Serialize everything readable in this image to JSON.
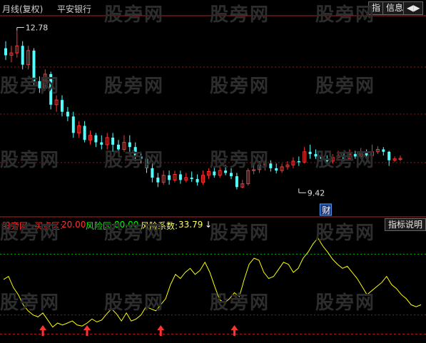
{
  "header": {
    "period": "月线(复权)",
    "stock": "平安银行",
    "btn_indicator": "指",
    "btn_info": "信息",
    "btn_arrows": "◀▶"
  },
  "watermark": "股旁网",
  "main_chart": {
    "high_label": "12.78",
    "low_label": "9.42",
    "finance_badge": "财"
  },
  "sub_header": {
    "name": "股旁网",
    "buy_zone_label": "买点区: ",
    "buy_zone_value": "20.00",
    "risk_zone_label": "风险区: ",
    "risk_zone_value": "80.00",
    "risk_coef_label": "风险系数: ",
    "risk_coef_value": "33.79",
    "risk_coef_arrow": "↓",
    "btn_explain": "指标说明"
  },
  "colors": {
    "up": "#ff3232",
    "down": "#54ffff",
    "grid": "#8a1a1a",
    "risk_line": "#00b000",
    "oscillator": "#ffff00",
    "label_buy": "#ff3232",
    "label_risk": "#00ff00",
    "label_coef": "#ffff60",
    "badge": "#5aa0ff"
  },
  "chart_data": [
    {
      "type": "candlestick",
      "title": "平安银行 月线(复权)",
      "ylim": [
        9.0,
        13.0
      ],
      "annotations": [
        {
          "text": "12.78",
          "price": 12.78,
          "candle_index": 2
        },
        {
          "text": "9.42",
          "price": 9.42,
          "candle_index": 52
        }
      ],
      "candles": [
        [
          12.4,
          12.25,
          12.55,
          12.15
        ],
        [
          12.25,
          12.3,
          12.45,
          12.1
        ],
        [
          12.3,
          12.45,
          12.78,
          12.2
        ],
        [
          12.45,
          12.05,
          12.55,
          11.95
        ],
        [
          12.05,
          12.35,
          12.45,
          11.95
        ],
        [
          12.35,
          11.7,
          12.4,
          11.6
        ],
        [
          11.7,
          11.55,
          11.8,
          11.45
        ],
        [
          11.55,
          11.85,
          11.95,
          11.5
        ],
        [
          11.85,
          11.2,
          11.9,
          11.1
        ],
        [
          11.2,
          11.3,
          11.4,
          11.05
        ],
        [
          11.3,
          11.05,
          11.4,
          10.95
        ],
        [
          11.05,
          10.95,
          11.15,
          10.85
        ],
        [
          10.95,
          10.6,
          11.05,
          10.5
        ],
        [
          10.6,
          10.75,
          10.85,
          10.5
        ],
        [
          10.75,
          10.45,
          10.85,
          10.4
        ],
        [
          10.45,
          10.55,
          10.65,
          10.35
        ],
        [
          10.55,
          10.4,
          10.6,
          10.3
        ],
        [
          10.4,
          10.35,
          10.55,
          10.25
        ],
        [
          10.35,
          10.5,
          10.6,
          10.25
        ],
        [
          10.5,
          10.35,
          10.6,
          10.2
        ],
        [
          10.35,
          10.25,
          10.45,
          10.15
        ],
        [
          10.25,
          10.4,
          10.55,
          10.2
        ],
        [
          10.4,
          10.3,
          10.55,
          10.2
        ],
        [
          10.3,
          10.1,
          10.4,
          10.0
        ],
        [
          10.1,
          10.05,
          10.2,
          9.95
        ],
        [
          10.05,
          9.85,
          10.15,
          9.75
        ],
        [
          9.85,
          9.65,
          9.95,
          9.55
        ],
        [
          9.65,
          9.55,
          9.75,
          9.45
        ],
        [
          9.55,
          9.7,
          9.8,
          9.5
        ],
        [
          9.7,
          9.6,
          9.8,
          9.5
        ],
        [
          9.6,
          9.72,
          9.8,
          9.55
        ],
        [
          9.72,
          9.6,
          9.8,
          9.52
        ],
        [
          9.6,
          9.65,
          9.75,
          9.55
        ],
        [
          9.65,
          9.62,
          9.78,
          9.56
        ],
        [
          9.62,
          9.55,
          9.72,
          9.48
        ],
        [
          9.55,
          9.7,
          9.8,
          9.5
        ],
        [
          9.7,
          9.78,
          9.85,
          9.62
        ],
        [
          9.78,
          9.7,
          9.88,
          9.65
        ],
        [
          9.7,
          9.8,
          9.9,
          9.65
        ],
        [
          9.8,
          9.75,
          9.92,
          9.7
        ],
        [
          9.75,
          9.68,
          9.85,
          9.62
        ],
        [
          9.68,
          9.45,
          9.75,
          9.4
        ],
        [
          9.45,
          9.52,
          9.6,
          9.42
        ],
        [
          9.52,
          9.8,
          9.85,
          9.48
        ],
        [
          9.8,
          9.82,
          9.92,
          9.72
        ],
        [
          9.82,
          9.92,
          10.0,
          9.75
        ],
        [
          9.92,
          9.95,
          10.02,
          9.8
        ],
        [
          9.95,
          9.85,
          10.02,
          9.78
        ],
        [
          9.85,
          9.8,
          9.95,
          9.74
        ],
        [
          9.8,
          9.88,
          9.95,
          9.75
        ],
        [
          9.88,
          9.92,
          10.0,
          9.82
        ],
        [
          9.92,
          10.0,
          10.08,
          9.85
        ],
        [
          10.0,
          9.98,
          10.1,
          9.9
        ],
        [
          9.98,
          10.2,
          10.3,
          9.95
        ],
        [
          10.2,
          10.15,
          10.35,
          10.05
        ],
        [
          10.15,
          10.1,
          10.25,
          10.05
        ],
        [
          10.1,
          10.05,
          10.15,
          9.98
        ],
        [
          10.05,
          10.0,
          10.12,
          9.92
        ],
        [
          10.0,
          10.08,
          10.15,
          9.95
        ],
        [
          10.08,
          10.12,
          10.22,
          10.02
        ],
        [
          10.12,
          10.05,
          10.2,
          10.0
        ],
        [
          10.05,
          10.15,
          10.25,
          10.02
        ],
        [
          10.15,
          10.1,
          10.22,
          10.05
        ],
        [
          10.1,
          10.18,
          10.28,
          10.05
        ],
        [
          10.18,
          10.12,
          10.25,
          10.08
        ],
        [
          10.12,
          10.2,
          10.35,
          10.1
        ],
        [
          10.2,
          10.25,
          10.32,
          10.15
        ],
        [
          10.25,
          10.2,
          10.3,
          10.12
        ],
        [
          10.2,
          10.02,
          10.22,
          9.9
        ],
        [
          10.02,
          10.05,
          10.1,
          9.98
        ],
        [
          10.05,
          10.06,
          10.12,
          10.0
        ]
      ]
    },
    {
      "type": "line",
      "title": "股旁网",
      "ylim": [
        0,
        100
      ],
      "series": [
        {
          "name": "风险系数",
          "values": [
            55,
            58,
            47,
            40,
            30,
            24,
            20,
            18,
            22,
            15,
            8,
            12,
            10,
            12,
            14,
            10,
            9,
            12,
            16,
            13,
            15,
            21,
            26,
            21,
            14,
            22,
            14,
            16,
            20,
            28,
            26,
            24,
            30,
            36,
            50,
            60,
            56,
            62,
            66,
            60,
            64,
            72,
            62,
            48,
            35,
            32,
            36,
            42,
            38,
            55,
            70,
            76,
            74,
            62,
            56,
            58,
            65,
            72,
            70,
            62,
            66,
            76,
            82,
            90,
            96,
            88,
            82,
            75,
            70,
            66,
            68,
            62,
            56,
            48,
            40,
            44,
            48,
            52,
            58,
            50,
            46,
            40,
            36,
            30,
            28,
            30
          ]
        }
      ],
      "reference_lines": [
        {
          "value": 80
        },
        {
          "value": 20
        }
      ],
      "markers": [
        {
          "type": "up-arrow",
          "x": 8
        },
        {
          "type": "up-arrow",
          "x": 17
        },
        {
          "type": "up-arrow",
          "x": 32
        },
        {
          "type": "up-arrow",
          "x": 47
        }
      ]
    }
  ]
}
